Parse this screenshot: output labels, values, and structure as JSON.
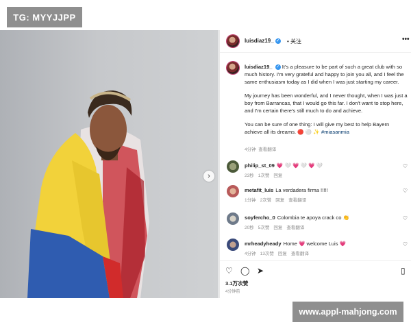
{
  "watermark_top": "TG: MYYJJPP",
  "watermark_bottom": "www.appl-mahjong.com",
  "post": {
    "username": "luisdiaz19_",
    "follow_label": "关注",
    "more_label": "•••",
    "caption": {
      "p1": "It's a pleasure to be part of such a great club with so much history. I'm very grateful and happy to join you all, and I feel the same enthusiasm today as I did when I was just starting my career.",
      "p2": "My journey has been wonderful, and I never thought, when I was just a boy from Barrancas, that I would go this far. I don't want to stop here, and I'm certain there's still much to do and achieve.",
      "p3": "You can be sure of one thing: I will give my best to help Bayern achieve all its dreams.",
      "emojis": "🔴 ⚪ ✨",
      "hashtag": "#miasanmia",
      "time": "4分钟",
      "translate": "查看翻译"
    },
    "comments": [
      {
        "user": "philip_st_09",
        "text": "💗 🤍 💗 🤍 💗 🤍",
        "time": "23秒",
        "likes": "1次赞",
        "reply": "回复",
        "translate": ""
      },
      {
        "user": "metafit_luis",
        "text": "La verdadera firma !!!!!",
        "time": "1分钟",
        "likes": "2次赞",
        "reply": "回复",
        "translate": "查看翻译"
      },
      {
        "user": "soyfercho_0",
        "text": "Colombia te apoya crack co 👏",
        "time": "20秒",
        "likes": "5次赞",
        "reply": "回复",
        "translate": "查看翻译"
      },
      {
        "user": "mrheadyheady",
        "text": "Home 💗 welcome Luis 💗",
        "time": "4分钟",
        "likes": "13次赞",
        "reply": "回复",
        "translate": "查看翻译"
      }
    ],
    "likes": "3.1万次赞",
    "posted": "4分钟前",
    "icons": [
      "heart-icon",
      "comment-icon",
      "share-icon",
      "bookmark-icon"
    ]
  }
}
